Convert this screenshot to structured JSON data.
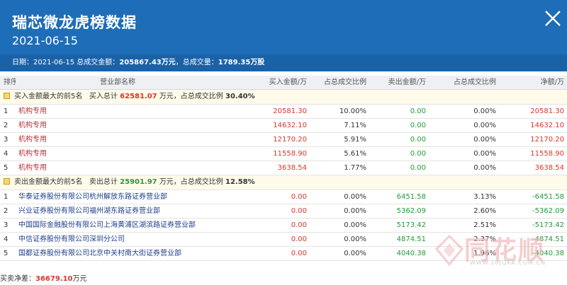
{
  "header": {
    "title": "瑞芯微龙虎榜数据",
    "date": "2021-06-15",
    "summary_prefix": "日期：2021-06-15 总成交金额：",
    "total_amount": "205867.43万元",
    "summary_mid": "，总成交量：",
    "total_volume": "1789.35万股"
  },
  "columns": [
    "排序",
    "营业部名称",
    "买入金额/万",
    "占总成交比例",
    "卖出金额/万",
    "占总成交比例",
    "净额/万"
  ],
  "buy_section": {
    "label": "买入金额最大的前5名",
    "total_prefix": "买入总计",
    "total": "62581.07",
    "total_suffix": "万元，占总成交比例",
    "ratio": "30.40%"
  },
  "buy_rows": [
    {
      "rank": "1",
      "name": "机构专用",
      "buy": "20581.30",
      "buy_ratio": "10.00%",
      "sell": "0.00",
      "sell_ratio": "0.00%",
      "net": "20581.30"
    },
    {
      "rank": "2",
      "name": "机构专用",
      "buy": "14632.10",
      "buy_ratio": "7.11%",
      "sell": "0.00",
      "sell_ratio": "0.00%",
      "net": "14632.10"
    },
    {
      "rank": "3",
      "name": "机构专用",
      "buy": "12170.20",
      "buy_ratio": "5.91%",
      "sell": "0.00",
      "sell_ratio": "0.00%",
      "net": "12170.20"
    },
    {
      "rank": "4",
      "name": "机构专用",
      "buy": "11558.90",
      "buy_ratio": "5.61%",
      "sell": "0.00",
      "sell_ratio": "0.00%",
      "net": "11558.90"
    },
    {
      "rank": "5",
      "name": "机构专用",
      "buy": "3638.54",
      "buy_ratio": "1.77%",
      "sell": "0.00",
      "sell_ratio": "0.00%",
      "net": "3638.54"
    }
  ],
  "sell_section": {
    "label": "卖出金额最大的前5名",
    "total_prefix": "卖出总计",
    "total": "25901.97",
    "total_suffix": "万元，占总成交比例",
    "ratio": "12.58%"
  },
  "sell_rows": [
    {
      "rank": "1",
      "name": "华泰证券股份有限公司杭州解放东路证券营业部",
      "buy": "0.00",
      "buy_ratio": "0.00%",
      "sell": "6451.58",
      "sell_ratio": "3.13%",
      "net": "-6451.58"
    },
    {
      "rank": "2",
      "name": "兴业证券股份有限公司福州湖东路证券营业部",
      "buy": "0.00",
      "buy_ratio": "0.00%",
      "sell": "5362.09",
      "sell_ratio": "2.60%",
      "net": "-5362.09"
    },
    {
      "rank": "3",
      "name": "中国国际金融股份有限公司上海黄浦区湖滨路证券营业部",
      "buy": "0.00",
      "buy_ratio": "0.00%",
      "sell": "5173.42",
      "sell_ratio": "2.51%",
      "net": "-5173.42"
    },
    {
      "rank": "4",
      "name": "中信证券股份有限公司深圳分公司",
      "buy": "0.00",
      "buy_ratio": "0.00%",
      "sell": "4874.51",
      "sell_ratio": "2.37%",
      "net": "-4874.51"
    },
    {
      "rank": "5",
      "name": "国都证券股份有限公司北京中关村南大街证券营业部",
      "buy": "0.00",
      "buy_ratio": "0.00%",
      "sell": "4040.38",
      "sell_ratio": "1.96%",
      "net": "-4040.38"
    }
  ],
  "net_buy": {
    "label": "买卖净差：",
    "value": "36679.10",
    "unit": "万元"
  },
  "watermark": {
    "text": "同花顺",
    "sub": "WWW.10JQKA.COM.CN",
    "icon": "tonghuashun-logo-icon"
  },
  "colors": {
    "header_bg": "#1e6db8",
    "summary_bg": "#1a62a8",
    "up_red": "#d9362b",
    "down_green": "#229a3b"
  }
}
